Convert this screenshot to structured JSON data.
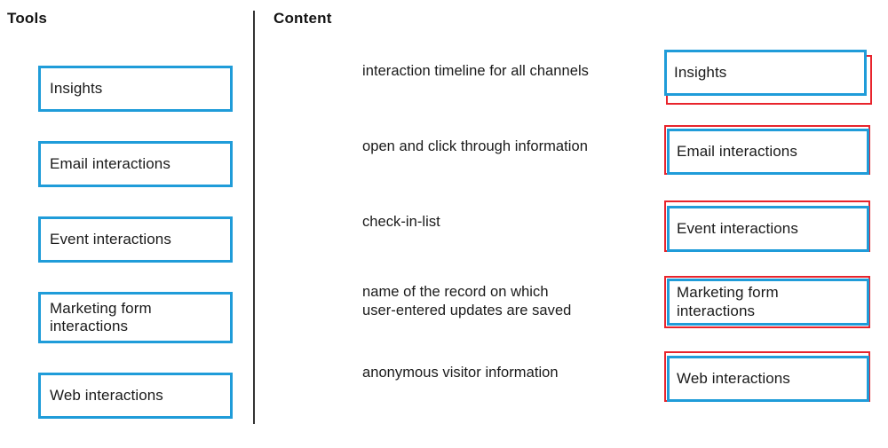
{
  "headers": {
    "tools": "Tools",
    "content": "Content"
  },
  "tools": {
    "items": [
      {
        "label": "Insights"
      },
      {
        "label": "Email interactions"
      },
      {
        "label": "Event interactions"
      },
      {
        "label": "Marketing form\ninteractions"
      },
      {
        "label": "Web interactions"
      }
    ]
  },
  "content": {
    "rows": [
      {
        "description": "interaction timeline for all channels",
        "answer": "Insights"
      },
      {
        "description": "open and click through information",
        "answer": "Email interactions"
      },
      {
        "description": "check-in-list",
        "answer": "Event interactions"
      },
      {
        "description": "name of the record on which\nuser-entered updates are saved",
        "answer": "Marketing form\ninteractions"
      },
      {
        "description": "anonymous visitor information",
        "answer": "Web interactions"
      }
    ]
  },
  "colors": {
    "box_blue": "#1f9cd9",
    "box_red": "#e8242c",
    "divider": "#333333",
    "text": "#1a1a1a",
    "background": "#ffffff"
  }
}
